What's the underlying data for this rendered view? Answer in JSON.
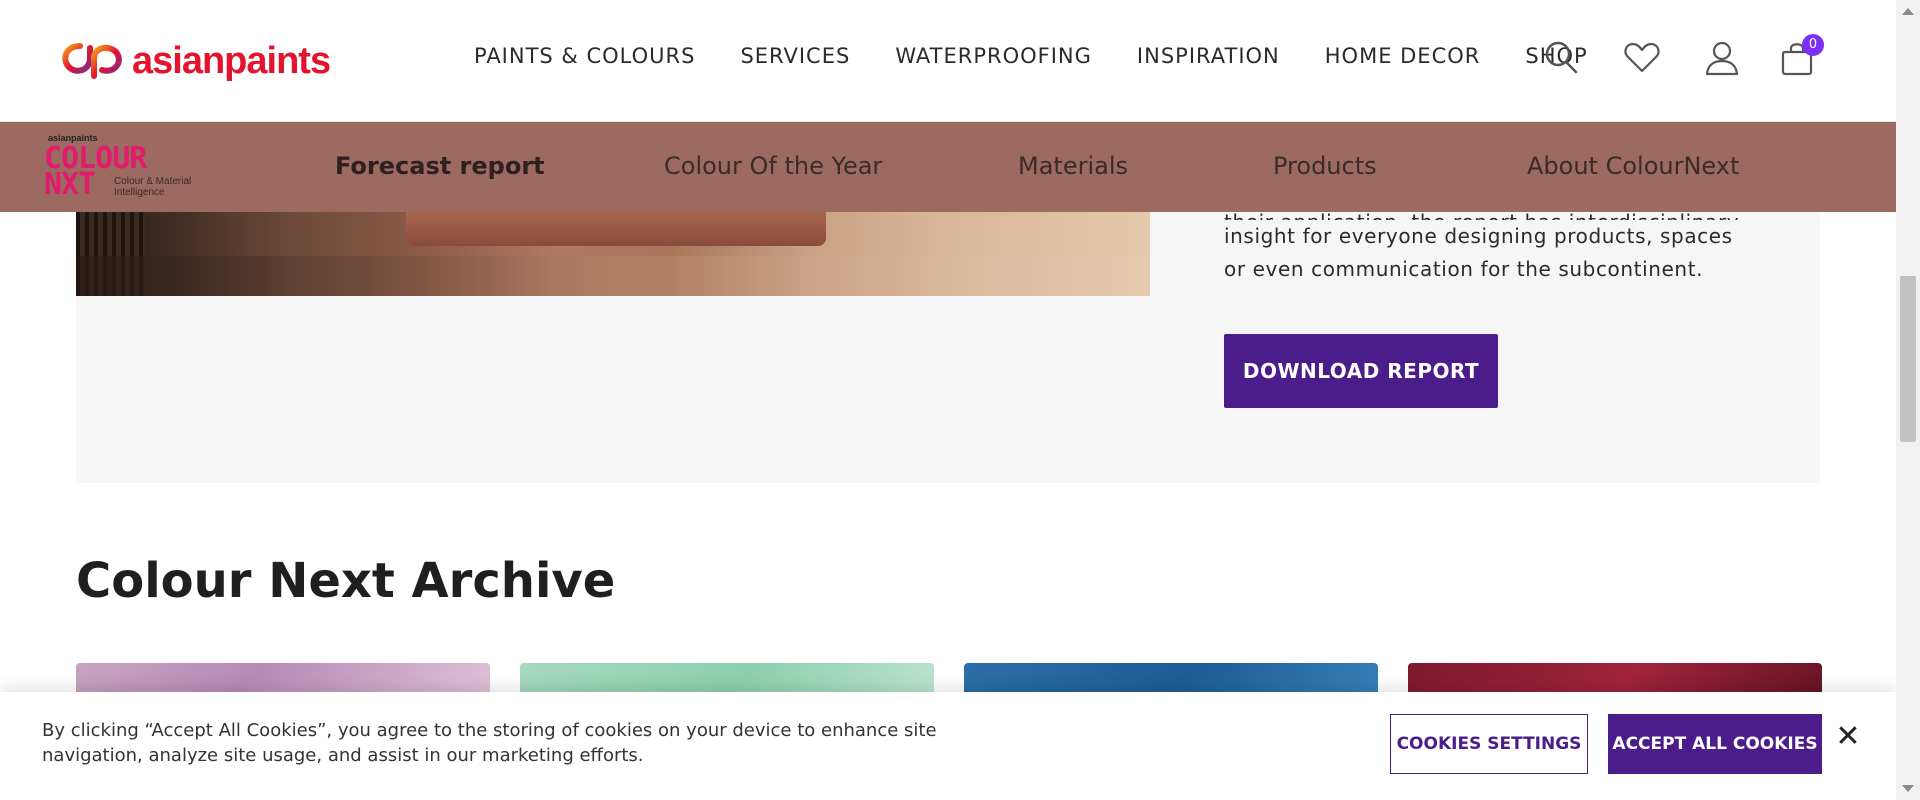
{
  "header": {
    "brand": "asianpaints",
    "nav": [
      "PAINTS & COLOURS",
      "SERVICES",
      "WATERPROOFING",
      "INSPIRATION",
      "HOME DECOR",
      "SHOP"
    ],
    "icons": [
      "search-icon",
      "wishlist-heart-icon",
      "user-icon",
      "cart-icon"
    ],
    "cart_count": "0"
  },
  "subnav": {
    "logo_brand": "asianpaints",
    "logo_line1": "COLOUR",
    "logo_line2": "NXT",
    "logo_tag": "Colour & Material Intelligence",
    "links": [
      "Forecast report",
      "Colour Of the Year",
      "Materials",
      "Products",
      "About ColourNext"
    ],
    "active_index": 0,
    "background": "#9c6a61"
  },
  "report": {
    "text_line_clipped": "their application, the report has interdisciplinary",
    "text_line_2": "insight for everyone designing products, spaces",
    "text_line_3": "or even communication for the subcontinent.",
    "download_label": "DOWNLOAD REPORT"
  },
  "archive": {
    "title": "Colour Next Archive"
  },
  "cookie": {
    "text": "By clicking “Accept All Cookies”, you agree to the storing of cookies on your device to enhance site navigation, analyze site usage, and assist in our marketing efforts.",
    "settings_label": "COOKIES SETTINGS",
    "accept_label": "ACCEPT ALL COOKIES",
    "close_glyph": "✕"
  },
  "colors": {
    "accent": "#4a1d8a",
    "brand_red": "#e3142d",
    "badge": "#7b2ff7"
  }
}
